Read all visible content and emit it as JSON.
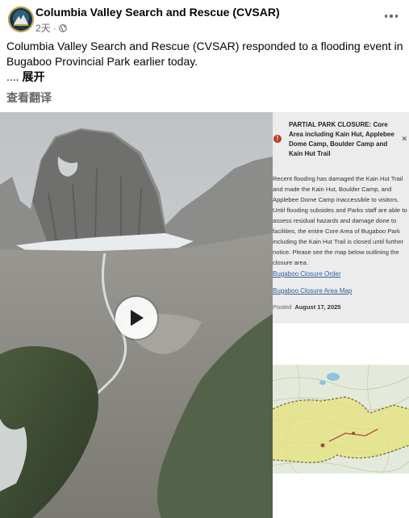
{
  "post": {
    "page_name": "Columbia Valley Search and Rescue (CVSAR)",
    "time": "2天",
    "dot": "·",
    "text": "Columbia Valley Search and Rescue (CVSAR) responded to a flooding event in Bugaboo Provincial Park earlier today.",
    "ellipsis": "....",
    "see_more": "展开",
    "translate": "查看翻译",
    "icons": {
      "more": "more-horizontal-icon",
      "audience": "globe-icon",
      "play": "play-icon",
      "alert": "alert-icon"
    }
  },
  "notice": {
    "heading": "PARTIAL PARK CLOSURE: Core Area including Kain Hut, Applebee Dome Camp, Boulder Camp and Kain Hut Trail",
    "alert_symbol": "!",
    "close_symbol": "✕",
    "body": "Recent flooding has damaged the Kain Hut Trail and made the Kain Hut, Boulder Camp, and Applebee Dome Camp inaccessible to visitors. Until flooding subsides and Parks staff are able to assess residual hazards and damage done to facilities, the entire Core Area of Bugaboo Park including the Kain Hut Trail is closed until further notice. Please see the map below outlining the closure area.",
    "link1": "Bugaboo Closure Order",
    "link2": "Bugaboo Closure Area Map",
    "posted_label": "Posted",
    "posted_date": "August 17, 2025"
  },
  "colors": {
    "alert": "#c0392b",
    "link": "#2f5f9a",
    "secondary_text": "#65676b",
    "closure_area": "#e6e27a"
  }
}
